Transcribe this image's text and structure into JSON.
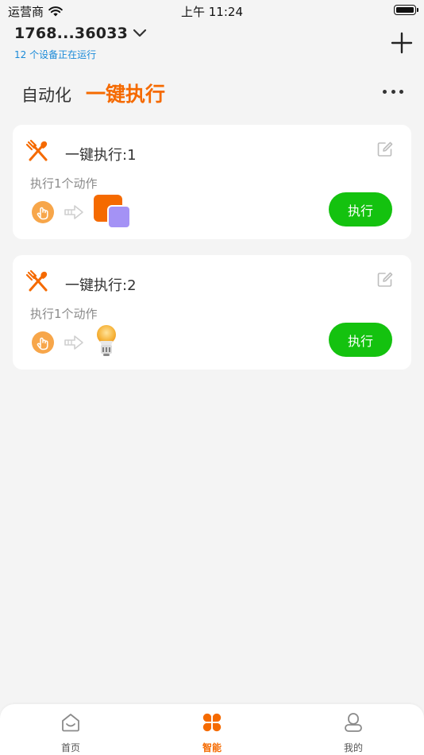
{
  "status_bar": {
    "carrier": "运营商",
    "time": "上午 11:24"
  },
  "header": {
    "home_name": "1768...36033",
    "status_text": "12 个设备正在运行"
  },
  "tabs": {
    "automation": "自动化",
    "one_click": "一键执行"
  },
  "colors": {
    "accent": "#f56a00",
    "execute_green": "#14c20f",
    "status_blue": "#1a8ad8"
  },
  "scenes": [
    {
      "title": "一键执行:1",
      "subtitle": "执行1个动作",
      "execute_label": "执行",
      "icon": "fork-knife-icon",
      "target_icon": "device-squares-icon"
    },
    {
      "title": "一键执行:2",
      "subtitle": "执行1个动作",
      "execute_label": "执行",
      "icon": "fork-knife-icon",
      "target_icon": "light-bulb-icon"
    }
  ],
  "tabbar": {
    "home": "首页",
    "smart": "智能",
    "mine": "我的"
  }
}
